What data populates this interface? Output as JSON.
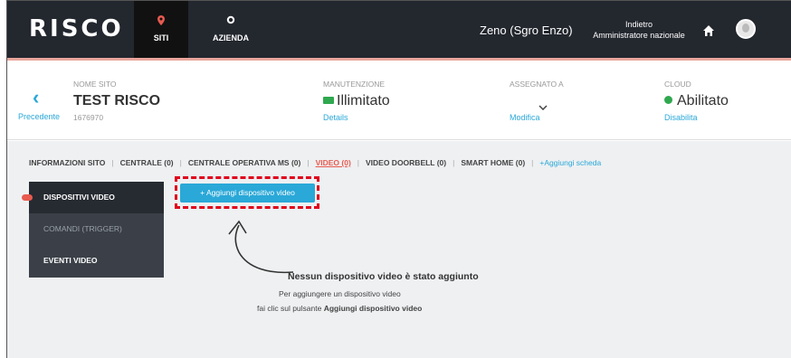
{
  "nav": {
    "logo": "RISCO",
    "items": [
      {
        "label": "SITI",
        "icon": "location-pin-icon"
      },
      {
        "label": "AZIENDA",
        "icon": "gear-icon"
      }
    ],
    "user_name": "Zeno (Sgro Enzo)",
    "back_label": "Indietro",
    "role_label": "Amministratore nazionale"
  },
  "site": {
    "back_label": "Precedente",
    "name_label": "NOME SITO",
    "name": "TEST RISCO",
    "code": "1676970",
    "maintenance_label": "MANUTENZIONE",
    "maintenance_value": "Illimitato",
    "maintenance_link": "Details",
    "assigned_label": "ASSEGNATO A",
    "assigned_value": "",
    "assigned_link": "Modifica",
    "cloud_label": "CLOUD",
    "cloud_value": "Abilitato",
    "cloud_link": "Disabilita"
  },
  "tabs": [
    "INFORMAZIONI SITO",
    "CENTRALE (0)",
    "CENTRALE OPERATIVA MS (0)",
    "VIDEO (0)",
    "VIDEO DOORBELL (0)",
    "SMART HOME (0)",
    "+Aggiungi scheda"
  ],
  "active_tab": "VIDEO (0)",
  "side_menu": [
    "DISPOSITIVI VIDEO",
    "COMANDI (TRIGGER)",
    "EVENTI VIDEO"
  ],
  "add_button": "+ Aggiungi dispositivo video",
  "empty": {
    "title": "Nessun dispositivo video è stato aggiunto",
    "line1": "Per aggiungere un dispositivo video",
    "line2_prefix": "fai clic sul pulsante ",
    "line2_bold": "Aggiungi dispositivo video"
  },
  "colors": {
    "nav_bg": "#23272e",
    "accent": "#e85a4f",
    "link": "#2aa8d8",
    "success": "#2fa84f",
    "highlight": "#e0001a"
  }
}
